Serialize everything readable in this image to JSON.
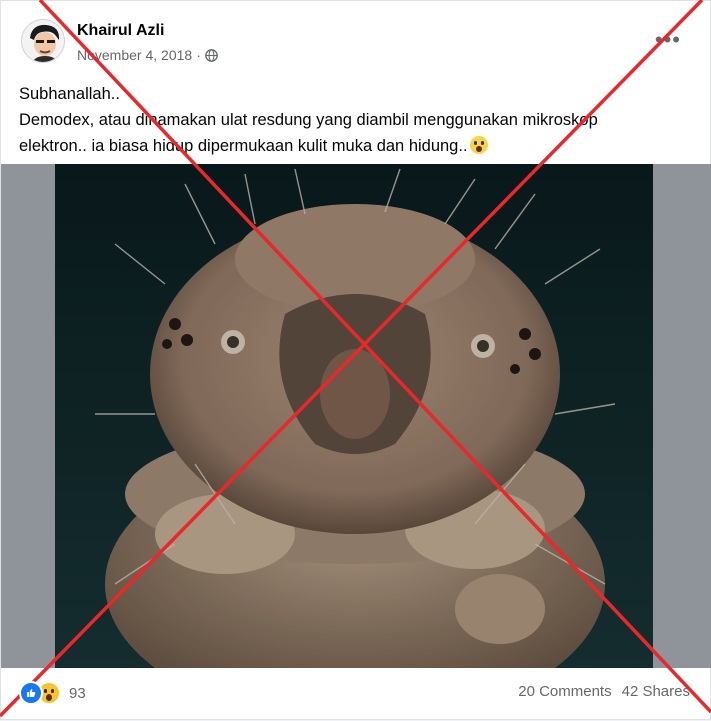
{
  "post": {
    "author": "Khairul Azli",
    "date": "November 4, 2018",
    "separator": "·",
    "audience_icon": "globe-icon",
    "caption_line1": "Subhanallah..",
    "caption_line2": "Demodex, atau dinamakan ulat resdung yang diambil menggunakan mikroskop",
    "caption_line3": "elektron.. ia biasa hidup dipermukaan kulit muka dan hidung..",
    "caption_emoji": "screaming-face-emoji"
  },
  "footer": {
    "reaction_icons": [
      "like-icon",
      "wow-icon"
    ],
    "reaction_count": "93",
    "comments": "20 Comments",
    "shares": "42 Shares"
  },
  "colors": {
    "cross": "#e8282b",
    "like": "#1877f2",
    "wow": "#f7c531",
    "meta_text": "#65676b"
  }
}
